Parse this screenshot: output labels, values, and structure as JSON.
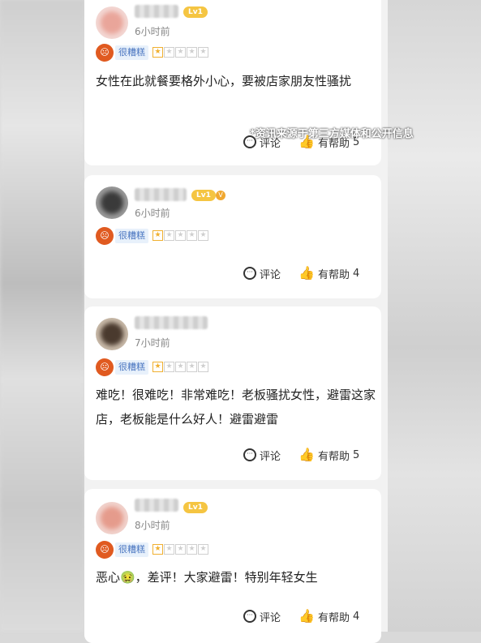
{
  "watermark": "*资讯来源于第三方媒体和公开信息",
  "level_badge": "Lv1",
  "rating_label": "很糟糕",
  "rating_stars": 0.5,
  "actions": {
    "comment": "评论",
    "helpful_prefix": "有帮助"
  },
  "colors": {
    "rating_face": "#e05a20",
    "level_badge": "#f5c542",
    "star_filled": "#f0b030"
  },
  "icons": {
    "comment": "comment-icon",
    "helpful": "thumbs-up-icon",
    "rating": "angry-face-icon"
  },
  "reviews": [
    {
      "time": "6小时前",
      "text": "女性在此就餐要格外小心，要被店家朋友性骚扰",
      "helpful_count": "5"
    },
    {
      "time": "6小时前",
      "text": "",
      "helpful_count": "4"
    },
    {
      "time": "7小时前",
      "text": "难吃！很难吃！非常难吃！老板骚扰女性，避雷这家店，老板能是什么好人！避雷避雷",
      "helpful_count": "5"
    },
    {
      "time": "8小时前",
      "text": "恶心🤢，差评！大家避雷！特别年轻女生",
      "helpful_count": "4"
    }
  ]
}
